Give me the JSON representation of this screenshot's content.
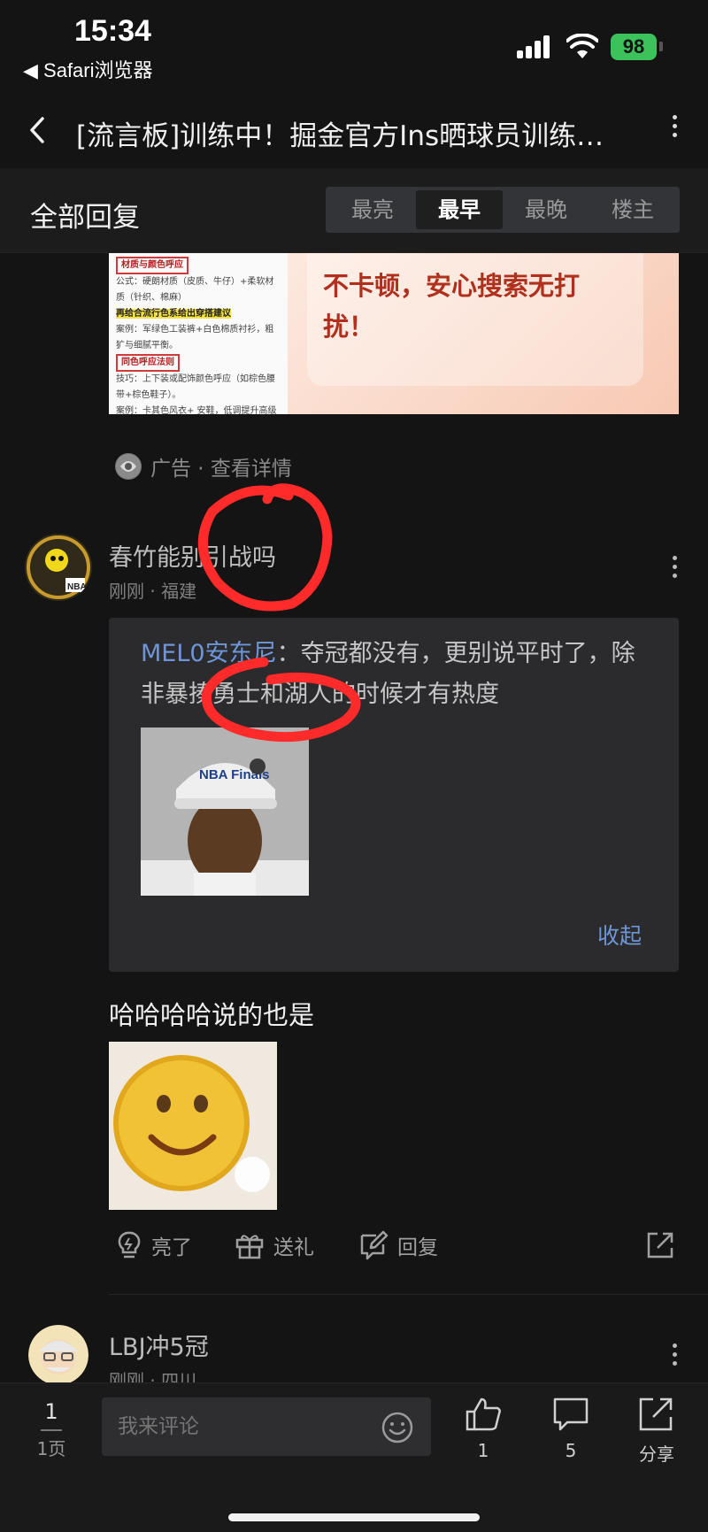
{
  "status_bar": {
    "time": "15:34",
    "back_app": "◀ Safari浏览器",
    "battery": "98"
  },
  "header": {
    "title": "[流言板]训练中！掘金官方Ins晒球员训练视频"
  },
  "replies": {
    "title": "全部回复",
    "tabs": [
      {
        "label": "最亮",
        "active": false
      },
      {
        "label": "最早",
        "active": true
      },
      {
        "label": "最晚",
        "active": false
      },
      {
        "label": "楼主",
        "active": false
      }
    ]
  },
  "ad": {
    "tag1": "材质与颜色呼应",
    "line1": "公式：硬朗材质（皮质、牛仔）+柔软材质（针织、棉麻）",
    "highlight": "再给合流行色系给出穿搭建议",
    "line2": "案例：军绿色工装裤+白色棉质衬衫，粗犷与细腻平衡。",
    "tag2": "同色呼应法则",
    "line3": "技巧：上下装或配饰颜色呼应（如棕色腰带+棕色鞋子）。",
    "line4": "案例：卡其色风衣+ 安鞋，低调提升高级感",
    "headline": "不卡顿，安心搜索无打扰！",
    "meta": "广告 · 查看详情"
  },
  "comment": {
    "user": "春竹能别引战吗",
    "meta": "刚刚 · 福建",
    "quote_user": "MEL0安东尼",
    "quote_text": "：夺冠都没有，更别说平时了，除非暴揍勇士和湖人的时候才有热度",
    "quote_img_cap": "NBA Finals",
    "collapse": "收起",
    "text": "哈哈哈哈说的也是",
    "actions": {
      "like": "亮了",
      "gift": "送礼",
      "reply": "回复"
    }
  },
  "next_comment": {
    "user": "LBJ冲5冠",
    "meta": "刚刚 · 四川"
  },
  "bottom": {
    "page": "1",
    "total": "1页",
    "placeholder": "我来评论",
    "likes": "1",
    "comments": "5",
    "share": "分享"
  },
  "colors": {
    "accent_blue": "#6e96d8",
    "annotation_red": "#ff2a2a",
    "battery_green": "#3cc25a"
  }
}
